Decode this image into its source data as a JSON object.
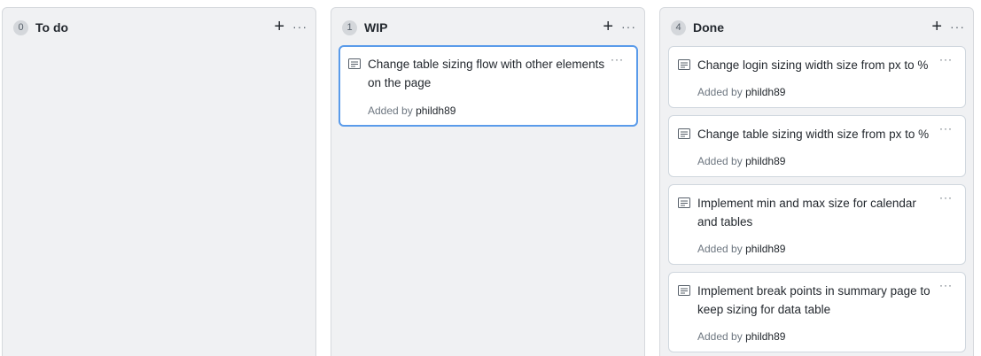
{
  "columns": [
    {
      "count": "0",
      "title": "To do",
      "add_label": "+",
      "more_label": "···",
      "cards": []
    },
    {
      "count": "1",
      "title": "WIP",
      "add_label": "+",
      "more_label": "···",
      "cards": [
        {
          "title": "Change table sizing flow with other elements on the page",
          "added_by_label": "Added by",
          "author": "phildh89",
          "more_label": "···"
        }
      ]
    },
    {
      "count": "4",
      "title": "Done",
      "add_label": "+",
      "more_label": "···",
      "cards": [
        {
          "title": "Change login sizing width size from px to %",
          "added_by_label": "Added by",
          "author": "phildh89",
          "more_label": "···"
        },
        {
          "title": "Change table sizing width size from px to %",
          "added_by_label": "Added by",
          "author": "phildh89",
          "more_label": "···"
        },
        {
          "title": "Implement min and max size for calendar and tables",
          "added_by_label": "Added by",
          "author": "phildh89",
          "more_label": "···"
        },
        {
          "title": "Implement break points in summary page to keep sizing for data table",
          "added_by_label": "Added by",
          "author": "phildh89",
          "more_label": "···"
        }
      ]
    }
  ],
  "icons": {
    "card_type": "note-icon",
    "add": "plus-icon",
    "menu": "kebab-icon"
  }
}
